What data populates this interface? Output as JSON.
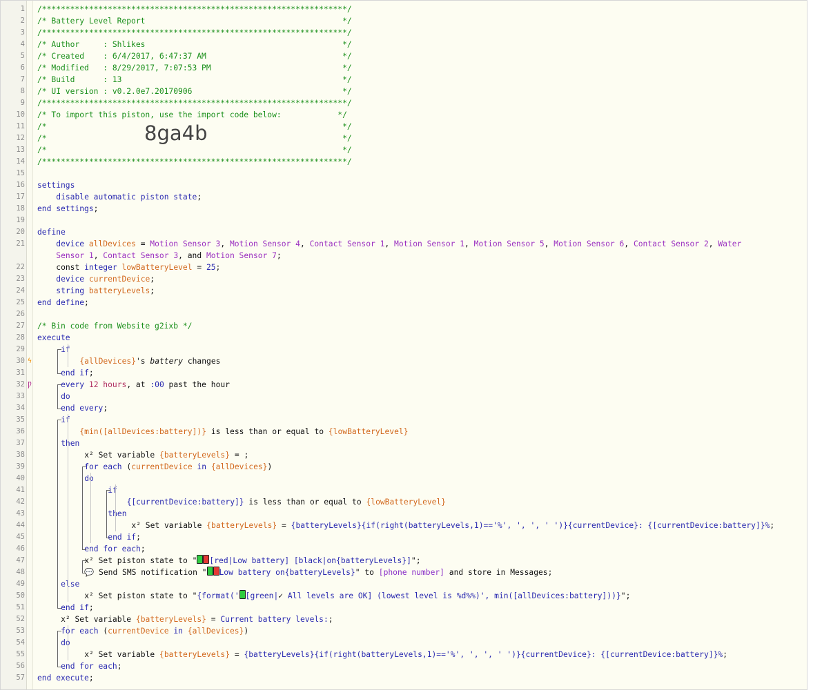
{
  "editor": {
    "import_code": "8ga4b",
    "lines": [
      {
        "n": "1",
        "t": [
          {
            "c": "c",
            "s": "/*****************************************************************/"
          }
        ]
      },
      {
        "n": "2",
        "t": [
          {
            "c": "c",
            "s": "/* Battery Level Report                                          */"
          }
        ]
      },
      {
        "n": "3",
        "t": [
          {
            "c": "c",
            "s": "/*****************************************************************/"
          }
        ]
      },
      {
        "n": "4",
        "t": [
          {
            "c": "c",
            "s": "/* Author     : Shlikes                                          */"
          }
        ]
      },
      {
        "n": "5",
        "t": [
          {
            "c": "c",
            "s": "/* Created    : 6/4/2017, 6:47:37 AM                             */"
          }
        ]
      },
      {
        "n": "6",
        "t": [
          {
            "c": "c",
            "s": "/* Modified   : 8/29/2017, 7:07:53 PM                            */"
          }
        ]
      },
      {
        "n": "7",
        "t": [
          {
            "c": "c",
            "s": "/* Build      : 13                                               */"
          }
        ]
      },
      {
        "n": "8",
        "t": [
          {
            "c": "c",
            "s": "/* UI version : v0.2.0e7.20170906                                */"
          }
        ]
      },
      {
        "n": "9",
        "t": [
          {
            "c": "c",
            "s": "/*****************************************************************/"
          }
        ]
      },
      {
        "n": "10",
        "t": [
          {
            "c": "c",
            "s": "/* To import this piston, use the import code below:            */"
          }
        ]
      },
      {
        "n": "11",
        "t": [
          {
            "c": "c",
            "s": "/*                                                               */"
          }
        ]
      },
      {
        "n": "12",
        "t": [
          {
            "c": "c",
            "s": "/*                                                               */"
          }
        ],
        "import": true
      },
      {
        "n": "13",
        "t": [
          {
            "c": "c",
            "s": "/*                                                               */"
          }
        ]
      },
      {
        "n": "14",
        "t": [
          {
            "c": "c",
            "s": "/*****************************************************************/"
          }
        ]
      },
      {
        "n": "15",
        "t": []
      },
      {
        "n": "16",
        "t": [
          {
            "c": "k",
            "s": "settings"
          }
        ]
      },
      {
        "n": "17",
        "i": 4,
        "t": [
          {
            "c": "k",
            "s": "disable automatic piston state"
          },
          {
            "c": "",
            "s": ";"
          }
        ]
      },
      {
        "n": "18",
        "t": [
          {
            "c": "k",
            "s": "end settings"
          },
          {
            "c": "",
            "s": ";"
          }
        ]
      },
      {
        "n": "19",
        "t": []
      },
      {
        "n": "20",
        "t": [
          {
            "c": "k",
            "s": "define"
          }
        ]
      },
      {
        "n": "21",
        "i": 4,
        "t": [
          {
            "c": "k",
            "s": "device "
          },
          {
            "c": "v",
            "s": "allDevices"
          },
          {
            "c": "",
            "s": " = "
          },
          {
            "c": "d",
            "s": "Motion Sensor 3"
          },
          {
            "c": "",
            "s": ", "
          },
          {
            "c": "d",
            "s": "Motion Sensor 4"
          },
          {
            "c": "",
            "s": ", "
          },
          {
            "c": "d",
            "s": "Contact Sensor 1"
          },
          {
            "c": "",
            "s": ", "
          },
          {
            "c": "d",
            "s": "Motion Sensor 1"
          },
          {
            "c": "",
            "s": ", "
          },
          {
            "c": "d",
            "s": "Motion Sensor 5"
          },
          {
            "c": "",
            "s": ", "
          },
          {
            "c": "d",
            "s": "Motion Sensor 6"
          },
          {
            "c": "",
            "s": ", "
          },
          {
            "c": "d",
            "s": "Contact Sensor 2"
          },
          {
            "c": "",
            "s": ", "
          },
          {
            "c": "d",
            "s": "Water"
          }
        ]
      },
      {
        "n": "",
        "i": 4,
        "t": [
          {
            "c": "d",
            "s": "Sensor 1"
          },
          {
            "c": "",
            "s": ", "
          },
          {
            "c": "d",
            "s": "Contact Sensor 3"
          },
          {
            "c": "",
            "s": ", and "
          },
          {
            "c": "d",
            "s": "Motion Sensor 7"
          },
          {
            "c": "",
            "s": ";"
          }
        ]
      },
      {
        "n": "22",
        "i": 4,
        "t": [
          {
            "c": "",
            "s": "const "
          },
          {
            "c": "k",
            "s": "integer "
          },
          {
            "c": "v",
            "s": "lowBatteryLevel"
          },
          {
            "c": "",
            "s": " = "
          },
          {
            "c": "k",
            "s": "25"
          },
          {
            "c": "",
            "s": ";"
          }
        ]
      },
      {
        "n": "23",
        "i": 4,
        "t": [
          {
            "c": "k",
            "s": "device "
          },
          {
            "c": "v",
            "s": "currentDevice"
          },
          {
            "c": "",
            "s": ";"
          }
        ]
      },
      {
        "n": "24",
        "i": 4,
        "t": [
          {
            "c": "k",
            "s": "string "
          },
          {
            "c": "v",
            "s": "batteryLevels"
          },
          {
            "c": "",
            "s": ";"
          }
        ]
      },
      {
        "n": "25",
        "t": [
          {
            "c": "k",
            "s": "end define"
          },
          {
            "c": "",
            "s": ";"
          }
        ]
      },
      {
        "n": "26",
        "t": []
      },
      {
        "n": "27",
        "t": [
          {
            "c": "c",
            "s": "/* Bin code from Website g2ixb */"
          }
        ]
      },
      {
        "n": "28",
        "t": [
          {
            "c": "k",
            "s": "execute"
          }
        ]
      },
      {
        "n": "29",
        "i": 5,
        "t": [
          {
            "c": "k",
            "s": "if"
          }
        ]
      },
      {
        "n": "30",
        "i": 9,
        "m": "ϟ",
        "t": [
          {
            "c": "v",
            "s": "{allDevices}"
          },
          {
            "c": "",
            "s": "'s "
          },
          {
            "c": "",
            "s": "battery",
            "it": true
          },
          {
            "c": "",
            "s": " changes"
          }
        ]
      },
      {
        "n": "31",
        "i": 5,
        "t": [
          {
            "c": "k",
            "s": "end if"
          },
          {
            "c": "",
            "s": ";"
          }
        ]
      },
      {
        "n": "32",
        "i": 5,
        "m": "Ƿ",
        "t": [
          {
            "c": "k",
            "s": "every "
          },
          {
            "c": "n",
            "s": "12 hours"
          },
          {
            "c": "",
            "s": ", at "
          },
          {
            "c": "k",
            "s": ":00"
          },
          {
            "c": "",
            "s": " past the hour"
          }
        ]
      },
      {
        "n": "33",
        "i": 5,
        "t": [
          {
            "c": "k",
            "s": "do"
          }
        ]
      },
      {
        "n": "34",
        "i": 5,
        "t": [
          {
            "c": "k",
            "s": "end every"
          },
          {
            "c": "",
            "s": ";"
          }
        ]
      },
      {
        "n": "35",
        "i": 5,
        "t": [
          {
            "c": "k",
            "s": "if"
          }
        ]
      },
      {
        "n": "36",
        "i": 9,
        "t": [
          {
            "c": "v",
            "s": "{min([allDevices:battery])}"
          },
          {
            "c": "",
            "s": " is less than or equal to "
          },
          {
            "c": "v",
            "s": "{lowBatteryLevel}"
          }
        ]
      },
      {
        "n": "37",
        "i": 5,
        "t": [
          {
            "c": "k",
            "s": "then"
          }
        ]
      },
      {
        "n": "38",
        "i": 10,
        "t": [
          {
            "c": "",
            "s": "x² Set variable "
          },
          {
            "c": "v",
            "s": "{batteryLevels}"
          },
          {
            "c": "",
            "s": " = ;"
          }
        ]
      },
      {
        "n": "39",
        "i": 10,
        "t": [
          {
            "c": "k",
            "s": "for each "
          },
          {
            "c": "",
            "s": "("
          },
          {
            "c": "v",
            "s": "currentDevice"
          },
          {
            "c": "k",
            "s": " in "
          },
          {
            "c": "v",
            "s": "{allDevices}"
          },
          {
            "c": "",
            "s": ")"
          }
        ]
      },
      {
        "n": "40",
        "i": 10,
        "t": [
          {
            "c": "k",
            "s": "do"
          }
        ]
      },
      {
        "n": "41",
        "i": 15,
        "t": [
          {
            "c": "k",
            "s": "if"
          }
        ]
      },
      {
        "n": "42",
        "i": 19,
        "t": [
          {
            "c": "k",
            "s": "{[currentDevice:battery]}"
          },
          {
            "c": "",
            "s": " is less than or equal to "
          },
          {
            "c": "v",
            "s": "{lowBatteryLevel}"
          }
        ]
      },
      {
        "n": "43",
        "i": 15,
        "t": [
          {
            "c": "k",
            "s": "then"
          }
        ]
      },
      {
        "n": "44",
        "i": 20,
        "t": [
          {
            "c": "",
            "s": "x² Set variable "
          },
          {
            "c": "v",
            "s": "{batteryLevels}"
          },
          {
            "c": "",
            "s": " = "
          },
          {
            "c": "k",
            "s": "{batteryLevels}{if(right(batteryLevels,1)=='%', ', ', ' ')}{currentDevice}: {[currentDevice:battery]}%"
          },
          {
            "c": "",
            "s": ";"
          }
        ]
      },
      {
        "n": "45",
        "i": 15,
        "t": [
          {
            "c": "k",
            "s": "end if"
          },
          {
            "c": "",
            "s": ";"
          }
        ]
      },
      {
        "n": "46",
        "i": 10,
        "t": [
          {
            "c": "k",
            "s": "end for each"
          },
          {
            "c": "",
            "s": ";"
          }
        ]
      },
      {
        "n": "47",
        "i": 10,
        "t": [
          {
            "c": "",
            "s": "x² Set piston state to \""
          },
          {
            "c": "",
            "s": "",
            "bat": "g"
          },
          {
            "c": "",
            "s": "",
            "bat": "r"
          },
          {
            "c": "k",
            "s": "[red|Low battery] [black|on{batteryLevels}]"
          },
          {
            "c": "",
            "s": "\";"
          }
        ]
      },
      {
        "n": "48",
        "i": 10,
        "t": [
          {
            "c": "",
            "s": "💬 Send SMS notification \""
          },
          {
            "c": "",
            "s": "",
            "bat": "g"
          },
          {
            "c": "",
            "s": "",
            "bat": "r"
          },
          {
            "c": "k",
            "s": "Low battery on{batteryLevels}"
          },
          {
            "c": "",
            "s": "\" to "
          },
          {
            "c": "s",
            "s": "[phone number]"
          },
          {
            "c": "",
            "s": " and store in Messages;"
          }
        ]
      },
      {
        "n": "49",
        "i": 5,
        "t": [
          {
            "c": "k",
            "s": "else"
          }
        ]
      },
      {
        "n": "50",
        "i": 10,
        "t": [
          {
            "c": "",
            "s": "x² Set piston state to \""
          },
          {
            "c": "k",
            "s": "{format('"
          },
          {
            "c": "",
            "s": "",
            "bat": "g"
          },
          {
            "c": "k",
            "s": "[green|"
          },
          {
            "c": "",
            "s": "✓"
          },
          {
            "c": "k",
            "s": " All levels are OK] (lowest level is %d%%)', min([allDevices:battery]))}"
          },
          {
            "c": "",
            "s": "\";"
          }
        ]
      },
      {
        "n": "51",
        "i": 5,
        "t": [
          {
            "c": "k",
            "s": "end if"
          },
          {
            "c": "",
            "s": ";"
          }
        ]
      },
      {
        "n": "52",
        "i": 5,
        "t": [
          {
            "c": "",
            "s": "x² Set variable "
          },
          {
            "c": "v",
            "s": "{batteryLevels}"
          },
          {
            "c": "",
            "s": " = "
          },
          {
            "c": "k",
            "s": "Current battery levels:"
          },
          {
            "c": "",
            "s": ";"
          }
        ]
      },
      {
        "n": "53",
        "i": 5,
        "t": [
          {
            "c": "k",
            "s": "for each "
          },
          {
            "c": "",
            "s": "("
          },
          {
            "c": "v",
            "s": "currentDevice"
          },
          {
            "c": "k",
            "s": " in "
          },
          {
            "c": "v",
            "s": "{allDevices}"
          },
          {
            "c": "",
            "s": ")"
          }
        ]
      },
      {
        "n": "54",
        "i": 5,
        "t": [
          {
            "c": "k",
            "s": "do"
          }
        ]
      },
      {
        "n": "55",
        "i": 10,
        "t": [
          {
            "c": "",
            "s": "x² Set variable "
          },
          {
            "c": "v",
            "s": "{batteryLevels}"
          },
          {
            "c": "",
            "s": " = "
          },
          {
            "c": "k",
            "s": "{batteryLevels}{if(right(batteryLevels,1)=='%', ', ', ' ')}{currentDevice}: {[currentDevice:battery]}%"
          },
          {
            "c": "",
            "s": ";"
          }
        ]
      },
      {
        "n": "56",
        "i": 5,
        "t": [
          {
            "c": "k",
            "s": "end for each"
          },
          {
            "c": "",
            "s": ";"
          }
        ]
      },
      {
        "n": "57",
        "t": [
          {
            "c": "k",
            "s": "end execute"
          },
          {
            "c": "",
            "s": ";"
          }
        ]
      }
    ]
  }
}
